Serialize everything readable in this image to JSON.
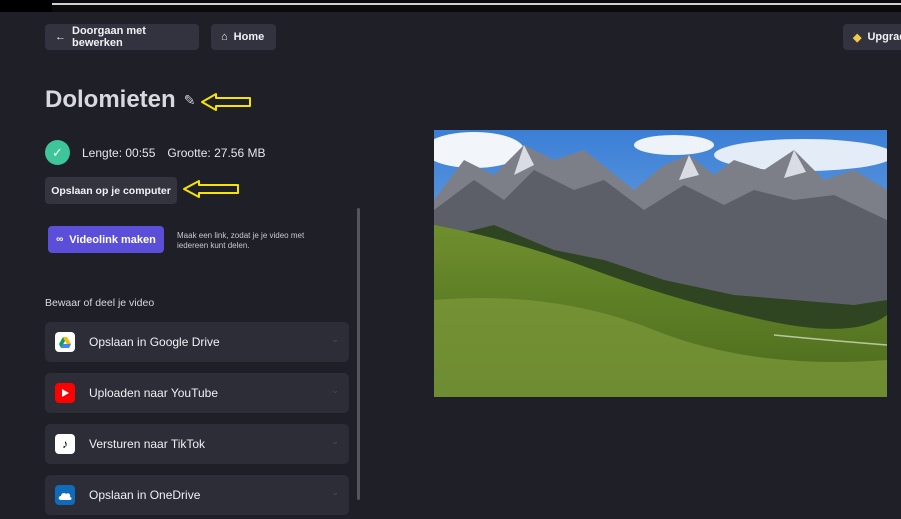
{
  "toolbar": {
    "back_label": "Doorgaan met bewerken",
    "home_label": "Home",
    "upgrade_label": "Upgrade"
  },
  "project": {
    "title": "Dolomieten",
    "length": "Lengte: 00:55",
    "size": "Grootte: 27.56 MB"
  },
  "actions": {
    "save_computer": "Opslaan op je computer",
    "videolink": "Videolink maken",
    "videolink_help": "Maak een link, zodat je je video met iedereen kunt delen."
  },
  "share": {
    "section_label": "Bewaar of deel je video",
    "items": [
      {
        "label": "Opslaan in Google Drive",
        "icon": "google-drive-icon"
      },
      {
        "label": "Uploaden naar YouTube",
        "icon": "youtube-icon"
      },
      {
        "label": "Versturen naar TikTok",
        "icon": "tiktok-icon"
      },
      {
        "label": "Opslaan in OneDrive",
        "icon": "onedrive-icon"
      }
    ]
  },
  "colors": {
    "background": "#1f1f28",
    "accent": "#5b4fd9",
    "success": "#3ec59a",
    "annotation": "#f5e400"
  }
}
